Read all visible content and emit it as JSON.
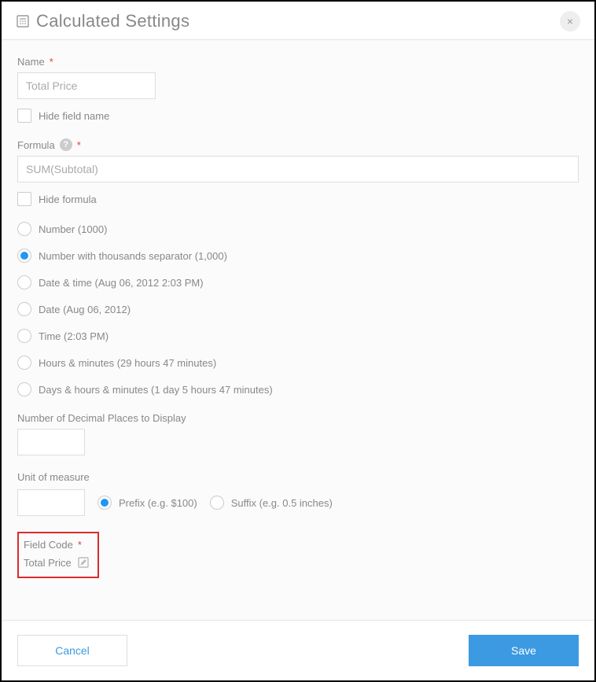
{
  "header": {
    "title": "Calculated Settings"
  },
  "name": {
    "label": "Name",
    "value": "Total Price",
    "hide_label": "Hide field name"
  },
  "formula": {
    "label": "Formula",
    "value": "SUM(Subtotal)",
    "hide_label": "Hide formula"
  },
  "format_options": {
    "number": "Number (1000)",
    "number_thousands": "Number with thousands separator (1,000)",
    "datetime": "Date & time (Aug 06, 2012 2:03 PM)",
    "date": "Date (Aug 06, 2012)",
    "time": "Time (2:03 PM)",
    "hours_minutes": "Hours & minutes (29 hours 47 minutes)",
    "days_hours_minutes": "Days & hours & minutes (1 day 5 hours 47 minutes)"
  },
  "decimals": {
    "label": "Number of Decimal Places to Display"
  },
  "unit": {
    "label": "Unit of measure",
    "prefix": "Prefix (e.g. $100)",
    "suffix": "Suffix (e.g. 0.5 inches)"
  },
  "field_code": {
    "label": "Field Code",
    "value": "Total Price"
  },
  "footer": {
    "cancel": "Cancel",
    "save": "Save"
  }
}
